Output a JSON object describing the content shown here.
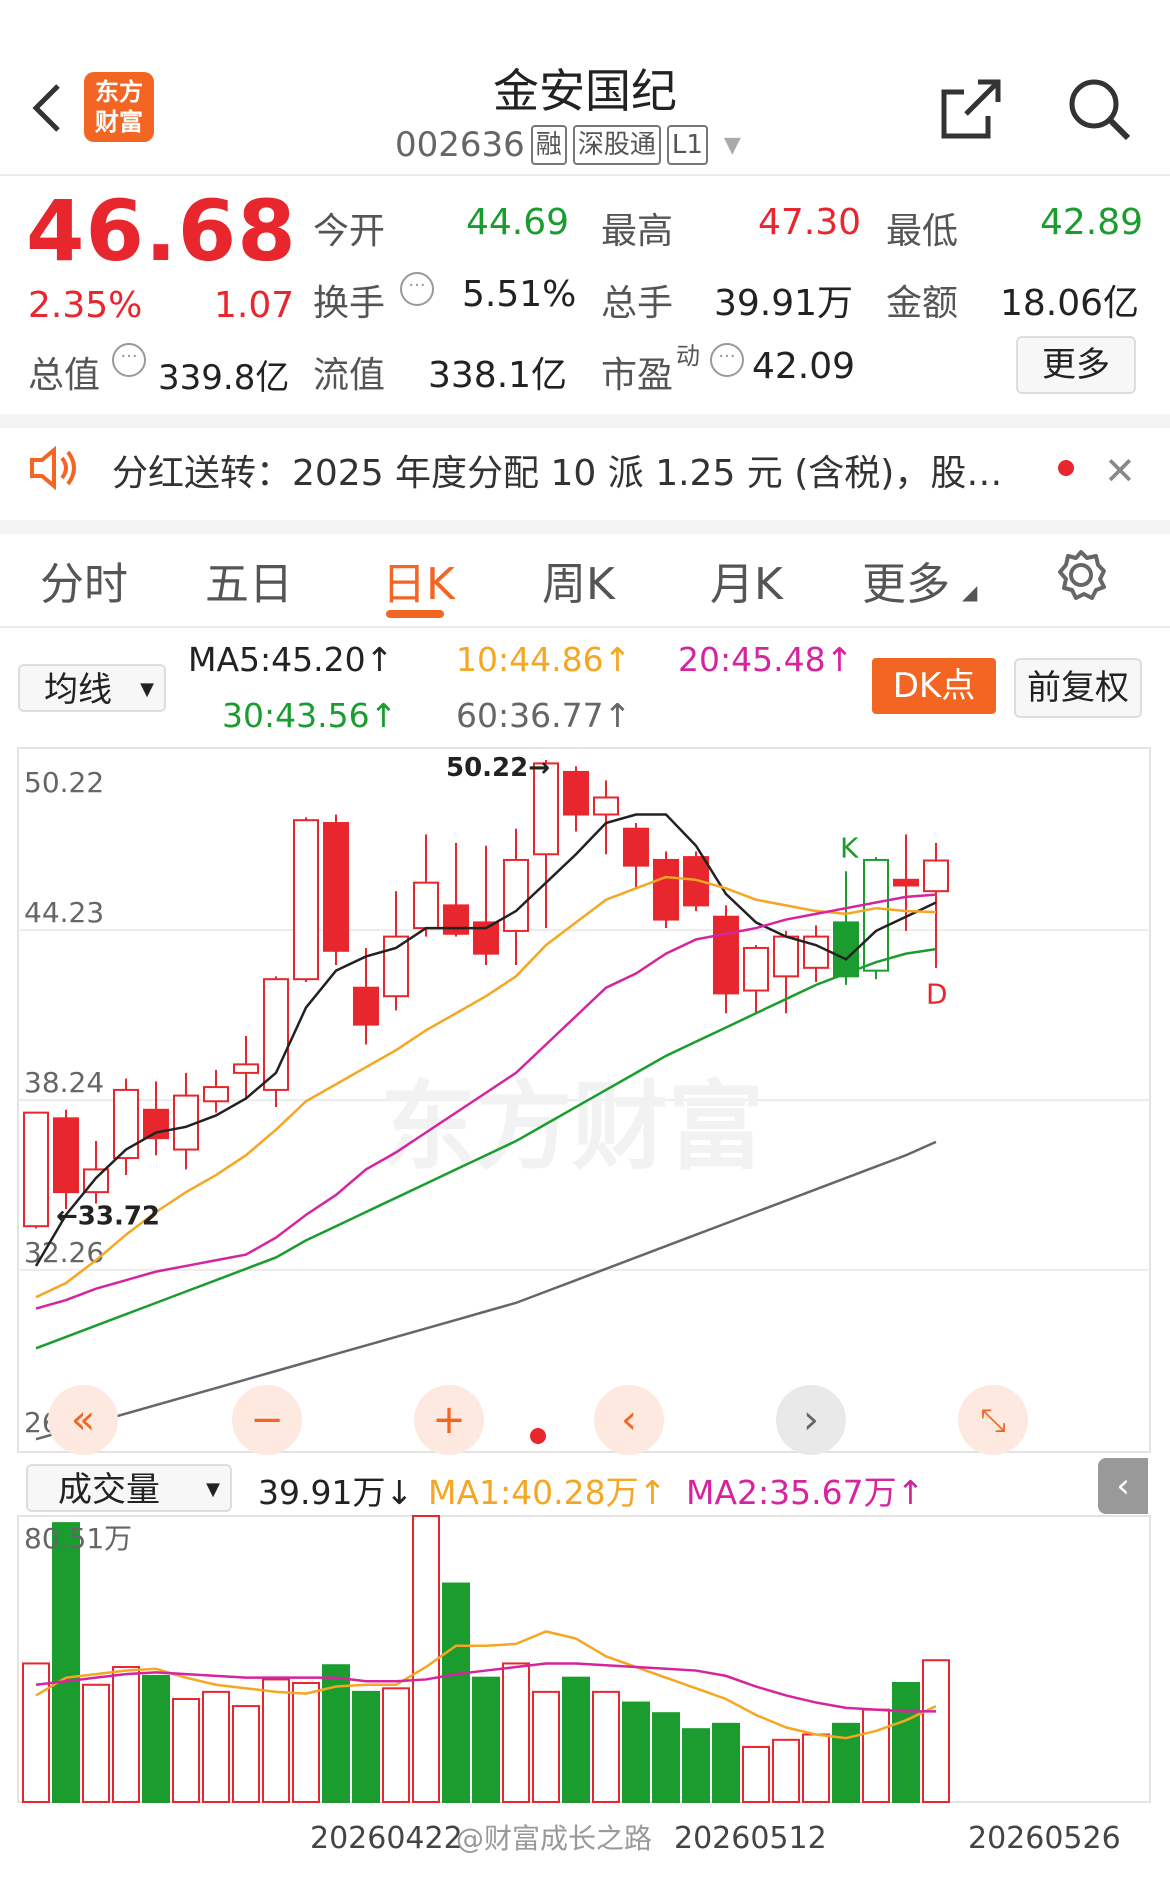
{
  "header": {
    "back_icon": "back-chevron-icon",
    "logo_text": "东方\n财富",
    "logo_line1": "东方",
    "logo_line2": "财富",
    "title": "金安国纪",
    "code": "002636",
    "tags": [
      "融",
      "深股通",
      "L1"
    ],
    "share_icon": "share-icon",
    "search_icon": "search-icon",
    "colors": {
      "logo_bg": "#f26522",
      "up": "#e8262d",
      "down": "#1a9c2e"
    }
  },
  "quote": {
    "price": "46.68",
    "change_pct": "2.35%",
    "change": "1.07",
    "open_label": "今开",
    "open": "44.69",
    "high_label": "最高",
    "high": "47.30",
    "low_label": "最低",
    "low": "42.89",
    "turnover_label": "换手",
    "turnover": "5.51%",
    "volume_label": "总手",
    "volume": "39.91万",
    "amount_label": "金额",
    "amount": "18.06亿",
    "mcap_label": "总值",
    "mcap": "339.8亿",
    "float_label": "流值",
    "float": "338.1亿",
    "pe_label": "市盈",
    "pe_sup": "动",
    "pe": "42.09",
    "more_label": "更多"
  },
  "notice": {
    "text": "分红送转：2025 年度分配 10 派 1.25 元 (含税)，股…"
  },
  "tabs": {
    "items": [
      "分时",
      "五日",
      "日K",
      "周K",
      "月K",
      "更多"
    ],
    "active": "日K"
  },
  "ma_bar": {
    "selector": "均线",
    "ma5": "MA5:45.20↑",
    "ma10": "10:44.86↑",
    "ma20": "20:45.48↑",
    "ma30": "30:43.56↑",
    "ma60": "60:36.77↑",
    "dk_label": "DK点",
    "adjust_label": "前复权",
    "colors": {
      "ma5": "#222222",
      "ma10": "#f5a623",
      "ma20": "#d6249f",
      "ma30": "#1a9c2e",
      "ma60": "#666666",
      "dk_bg": "#f26522"
    }
  },
  "chart_data": [
    {
      "type": "candlestick",
      "y_ticks": [
        "50.22",
        "44.23",
        "38.24",
        "32.26",
        "26.27"
      ],
      "ylim": [
        26.27,
        50.22
      ],
      "annotations": {
        "max_label": "50.22→",
        "min_label": "←33.72",
        "k_marker": "K",
        "d_marker": "D"
      },
      "candles": [
        {
          "o": 33.8,
          "c": 37.8,
          "h": 37.8,
          "l": 33.72
        },
        {
          "o": 37.6,
          "c": 35.0,
          "h": 37.9,
          "l": 34.4
        },
        {
          "o": 35.0,
          "c": 35.8,
          "h": 36.8,
          "l": 34.6
        },
        {
          "o": 36.2,
          "c": 38.6,
          "h": 39.0,
          "l": 35.6
        },
        {
          "o": 37.9,
          "c": 36.9,
          "h": 38.9,
          "l": 36.3
        },
        {
          "o": 36.5,
          "c": 38.4,
          "h": 39.2,
          "l": 35.8
        },
        {
          "o": 38.2,
          "c": 38.7,
          "h": 39.3,
          "l": 37.8
        },
        {
          "o": 39.2,
          "c": 39.5,
          "h": 40.5,
          "l": 38.3
        },
        {
          "o": 38.6,
          "c": 42.5,
          "h": 42.6,
          "l": 38.0
        },
        {
          "o": 42.5,
          "c": 48.1,
          "h": 48.2,
          "l": 42.4
        },
        {
          "o": 48.0,
          "c": 43.5,
          "h": 48.3,
          "l": 43.0
        },
        {
          "o": 42.2,
          "c": 40.9,
          "h": 43.6,
          "l": 40.2
        },
        {
          "o": 41.9,
          "c": 44.0,
          "h": 45.6,
          "l": 41.4
        },
        {
          "o": 44.3,
          "c": 45.9,
          "h": 47.6,
          "l": 44.0
        },
        {
          "o": 45.1,
          "c": 44.1,
          "h": 47.3,
          "l": 44.0
        },
        {
          "o": 44.5,
          "c": 43.4,
          "h": 47.2,
          "l": 43.0
        },
        {
          "o": 44.2,
          "c": 46.7,
          "h": 47.8,
          "l": 43.0
        },
        {
          "o": 46.9,
          "c": 50.1,
          "h": 50.22,
          "l": 44.3
        },
        {
          "o": 49.8,
          "c": 48.3,
          "h": 50.0,
          "l": 47.7
        },
        {
          "o": 48.3,
          "c": 48.9,
          "h": 49.5,
          "l": 46.9
        },
        {
          "o": 47.8,
          "c": 46.5,
          "h": 48.0,
          "l": 45.7
        },
        {
          "o": 46.7,
          "c": 44.6,
          "h": 47.0,
          "l": 44.3
        },
        {
          "o": 46.8,
          "c": 45.1,
          "h": 47.0,
          "l": 44.9
        },
        {
          "o": 44.7,
          "c": 42.0,
          "h": 45.1,
          "l": 41.3
        },
        {
          "o": 42.1,
          "c": 43.6,
          "h": 43.7,
          "l": 41.3
        },
        {
          "o": 42.6,
          "c": 44.0,
          "h": 44.2,
          "l": 41.3
        },
        {
          "o": 42.9,
          "c": 44.0,
          "h": 44.4,
          "l": 42.4
        },
        {
          "o": 44.5,
          "c": 42.6,
          "h": 46.3,
          "l": 42.3
        },
        {
          "o": 42.8,
          "c": 46.7,
          "h": 46.8,
          "l": 42.5
        },
        {
          "o": 46.0,
          "c": 45.8,
          "h": 47.6,
          "l": 44.2
        },
        {
          "o": 45.6,
          "c": 46.68,
          "h": 47.3,
          "l": 42.89
        }
      ],
      "series": [
        {
          "name": "MA5",
          "values": [
            32.4,
            34.2,
            35.5,
            36.5,
            37.1,
            37.3,
            37.7,
            38.3,
            39.2,
            41.5,
            42.8,
            43.3,
            43.6,
            44.3,
            44.3,
            44.3,
            44.9,
            45.9,
            46.9,
            48.0,
            48.3,
            48.3,
            47.2,
            45.5,
            44.5,
            44.0,
            43.7,
            43.2,
            44.2,
            44.7,
            45.2
          ]
        },
        {
          "name": "10",
          "values": [
            31.3,
            31.8,
            32.6,
            33.5,
            34.3,
            35.0,
            35.6,
            36.3,
            37.2,
            38.2,
            38.8,
            39.4,
            40.0,
            40.7,
            41.3,
            41.9,
            42.6,
            43.7,
            44.5,
            45.3,
            45.7,
            46.1,
            46.0,
            45.7,
            45.3,
            45.1,
            44.9,
            44.8,
            45.0,
            44.9,
            44.86
          ]
        },
        {
          "name": "20",
          "values": [
            30.9,
            31.2,
            31.6,
            31.9,
            32.2,
            32.4,
            32.6,
            32.8,
            33.4,
            34.2,
            34.9,
            35.8,
            36.4,
            37.1,
            37.8,
            38.5,
            39.2,
            40.2,
            41.2,
            42.2,
            42.7,
            43.4,
            43.9,
            44.1,
            44.3,
            44.6,
            44.8,
            45.0,
            45.2,
            45.4,
            45.48
          ]
        },
        {
          "name": "30",
          "values": [
            29.5,
            29.9,
            30.3,
            30.7,
            31.1,
            31.5,
            31.9,
            32.3,
            32.7,
            33.3,
            33.8,
            34.3,
            34.8,
            35.3,
            35.8,
            36.3,
            36.8,
            37.4,
            38.0,
            38.6,
            39.2,
            39.8,
            40.3,
            40.8,
            41.3,
            41.8,
            42.3,
            42.7,
            43.1,
            43.4,
            43.56
          ]
        },
        {
          "name": "60",
          "values": [
            26.3,
            26.6,
            26.9,
            27.2,
            27.5,
            27.8,
            28.1,
            28.4,
            28.7,
            29.0,
            29.3,
            29.6,
            29.9,
            30.2,
            30.5,
            30.8,
            31.1,
            31.5,
            31.9,
            32.3,
            32.7,
            33.1,
            33.5,
            33.9,
            34.3,
            34.7,
            35.1,
            35.5,
            35.9,
            36.3,
            36.77
          ]
        }
      ]
    },
    {
      "type": "bar",
      "title": "成交量",
      "values": [
        39.0,
        78.5,
        33.0,
        38.0,
        35.5,
        29.0,
        31.0,
        27.0,
        34.5,
        33.5,
        38.5,
        31.0,
        32.0,
        80.51,
        61.5,
        35.0,
        39.0,
        31.0,
        35.0,
        31.0,
        28.0,
        25.0,
        20.5,
        22.0,
        15.5,
        17.5,
        19.0,
        22.0,
        26.0,
        33.5,
        39.91
      ],
      "up_down": [
        "up",
        "down",
        "up",
        "up",
        "down",
        "up",
        "up",
        "up",
        "up",
        "up",
        "down",
        "down",
        "up",
        "up",
        "down",
        "down",
        "up",
        "up",
        "down",
        "up",
        "down",
        "down",
        "down",
        "down",
        "up",
        "up",
        "up",
        "down",
        "up",
        "down",
        "up"
      ],
      "y_tick": "80.51万",
      "x_labels": [
        "20260422",
        "20260512",
        "20260526"
      ],
      "legend": {
        "vol": "39.91万↓",
        "ma1": "MA1:40.28万↑",
        "ma2": "MA2:35.67万↑"
      },
      "series": [
        {
          "name": "MA1",
          "values": [
            30.0,
            35.0,
            36.0,
            37.0,
            37.5,
            35.0,
            33.0,
            32.0,
            31.0,
            30.5,
            32.5,
            33.0,
            33.0,
            38.0,
            44.0,
            44.0,
            44.5,
            48.0,
            46.0,
            41.0,
            38.0,
            35.0,
            32.0,
            29.0,
            24.5,
            21.0,
            19.0,
            18.0,
            20.0,
            23.0,
            27.0
          ]
        },
        {
          "name": "MA2",
          "values": [
            33.0,
            34.0,
            35.0,
            36.0,
            36.5,
            36.0,
            35.5,
            35.0,
            35.0,
            35.0,
            35.0,
            34.0,
            34.0,
            34.5,
            36.0,
            37.0,
            38.0,
            39.0,
            39.0,
            38.5,
            38.0,
            37.5,
            37.0,
            35.5,
            32.5,
            30.0,
            28.0,
            26.5,
            26.0,
            25.5,
            25.5
          ]
        }
      ]
    }
  ],
  "controls": {
    "icons": [
      "double-left-icon",
      "zoom-out-icon",
      "zoom-in-icon",
      "left-icon",
      "right-icon",
      "expand-icon"
    ],
    "collapse_icon": "collapse-left-icon"
  },
  "volume_bar": {
    "selector": "成交量"
  },
  "watermark": "东方财富",
  "footer_watermark": "@财富成长之路"
}
